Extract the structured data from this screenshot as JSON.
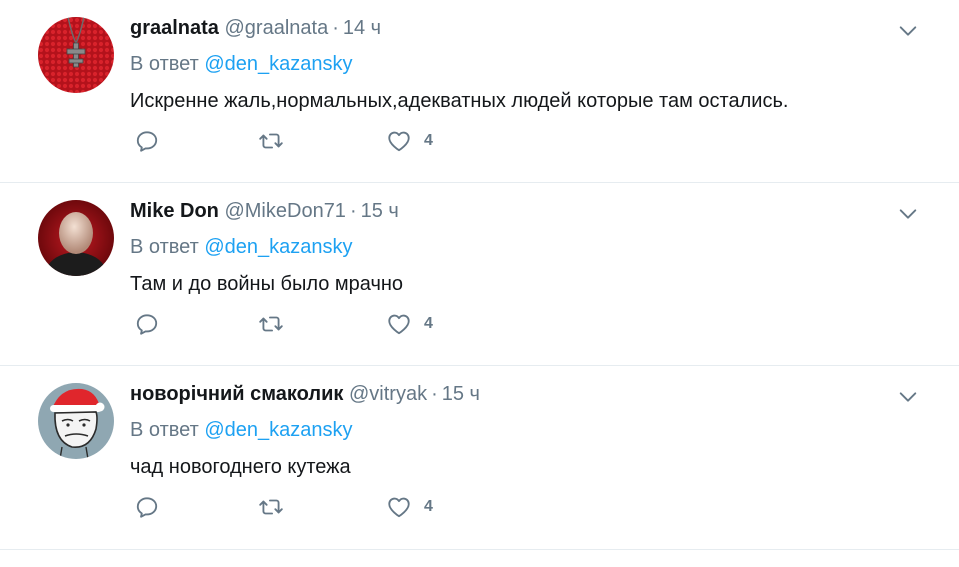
{
  "tweets": [
    {
      "name": "graalnata",
      "handle": "@graalnata",
      "separator": "·",
      "time": "14 ч",
      "reply_prefix": "В ответ",
      "reply_mention": "@den_kazansky",
      "text": "Искренне жаль,нормальных,адекватных людей которые там остались.",
      "likes": "4",
      "avatar": "red-knit-cross-avatar"
    },
    {
      "name": "Mike Don",
      "handle": "@MikeDon71",
      "separator": "·",
      "time": "15 ч",
      "reply_prefix": "В ответ",
      "reply_mention": "@den_kazansky",
      "text": "Там и до войны было мрачно",
      "likes": "4",
      "avatar": "bald-head-avatar"
    },
    {
      "name": "новорічний смаколик",
      "handle": "@vitryak",
      "separator": "·",
      "time": "15 ч",
      "reply_prefix": "В ответ",
      "reply_mention": "@den_kazansky",
      "text": "чад новогоднего кутежа",
      "likes": "4",
      "avatar": "santa-hat-meme-avatar"
    }
  ],
  "icons": {
    "reply": "reply-icon",
    "retweet": "retweet-icon",
    "like": "heart-icon",
    "menu": "chevron-down-icon"
  },
  "colors": {
    "link": "#1da1f2",
    "secondary": "#657786",
    "text": "#14171a",
    "divider": "#e6ecf0"
  }
}
